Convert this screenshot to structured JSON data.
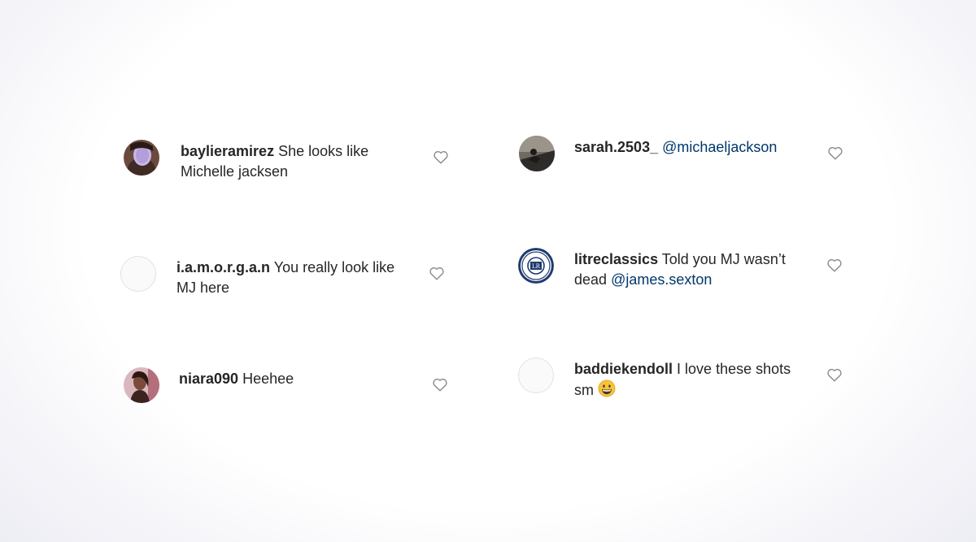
{
  "comments_left": [
    {
      "username": "baylieramirez",
      "line1": "She looks like",
      "line2": "Michelle jacksen"
    },
    {
      "username": "i.a.m.o.r.g.a.n",
      "line1": "You really look like",
      "line2": "MJ here"
    },
    {
      "username": "niara090",
      "line1": "Heehee"
    }
  ],
  "comments_right": [
    {
      "username": "sarah.2503_",
      "mention": "@michaeljackson"
    },
    {
      "username": "litreclassics",
      "line1": "Told you MJ wasn’t",
      "line2_prefix": "dead",
      "mention": "@james.sexton"
    },
    {
      "username": "baddiekendoll",
      "line1": "I love these shots",
      "line2": "sm"
    }
  ],
  "icons": {
    "like": "heart-outline-icon",
    "emoji": "grinning-face-emoji"
  },
  "colors": {
    "text": "#262626",
    "mention": "#00376b",
    "heart_stroke": "#8e8e8e"
  }
}
